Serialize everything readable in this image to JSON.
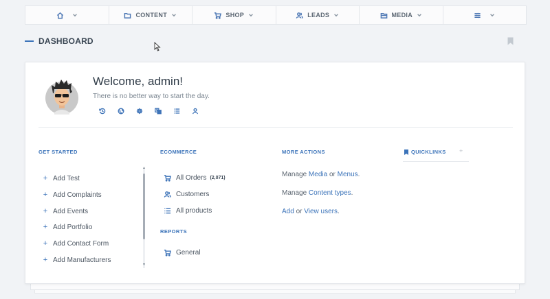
{
  "nav": {
    "items": [
      {
        "label": "",
        "icon": "home-icon"
      },
      {
        "label": "CONTENT",
        "icon": "folder-icon"
      },
      {
        "label": "SHOP",
        "icon": "cart-icon"
      },
      {
        "label": "LEADS",
        "icon": "users-icon"
      },
      {
        "label": "MEDIA",
        "icon": "folder-open-icon"
      },
      {
        "label": "",
        "icon": "sliders-icon"
      }
    ]
  },
  "page": {
    "title": "DASHBOARD"
  },
  "welcome": {
    "title": "Welcome, admin!",
    "subtitle": "There is no better way to start the day.",
    "quick_icons": [
      "history-icon",
      "globe-icon",
      "gear-icon",
      "translate-icon",
      "list-icon",
      "user-icon"
    ]
  },
  "get_started": {
    "heading": "GET STARTED",
    "items": [
      "Add Test",
      "Add Complaints",
      "Add Events",
      "Add Portfolio",
      "Add Contact Form",
      "Add Manufacturers"
    ]
  },
  "ecommerce": {
    "heading": "ECOMMERCE",
    "items": [
      {
        "label": "All Orders",
        "badge": "(2,071)",
        "icon": "cart-icon"
      },
      {
        "label": "Customers",
        "icon": "users-icon"
      },
      {
        "label": "All products",
        "icon": "list-icon"
      }
    ]
  },
  "reports": {
    "heading": "REPORTS",
    "items": [
      {
        "label": "General",
        "icon": "cart-icon"
      }
    ]
  },
  "more_actions": {
    "heading": "MORE ACTIONS",
    "line1": {
      "prefix": "Manage ",
      "link1": "Media",
      "mid": " or ",
      "link2": "Menus",
      "suffix": "."
    },
    "line2": {
      "prefix": "Manage ",
      "link1": "Content types",
      "suffix": "."
    },
    "line3": {
      "link1": "Add",
      "mid": " or ",
      "link2": "View users",
      "suffix": "."
    }
  },
  "quicklinks": {
    "heading": "QUICKLINKS",
    "add": "+"
  },
  "colors": {
    "accent": "#3b73b9",
    "background": "#f1f3f6",
    "card": "#ffffff"
  }
}
